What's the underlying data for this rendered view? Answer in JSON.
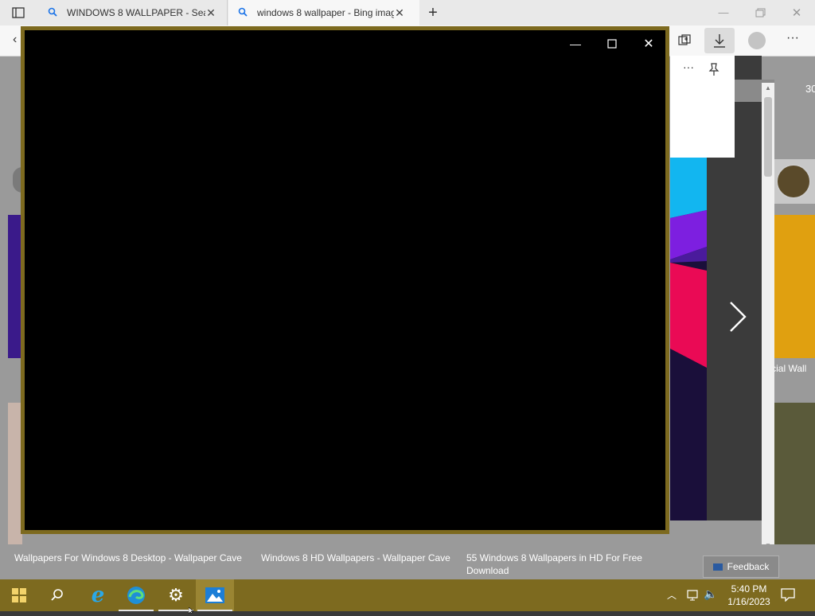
{
  "browser": {
    "tabs": [
      {
        "title": "WINDOWS 8 WALLPAPER - Searc"
      },
      {
        "title": "windows 8 wallpaper - Bing imag"
      }
    ]
  },
  "page": {
    "captions": [
      "Wallpapers For Windows 8 Desktop - Wallpaper Cave",
      "Windows 8 HD Wallpapers - Wallpaper Cave",
      "55 Windows 8 Wallpapers in HD For Free Download"
    ],
    "partial_right_caption": "fficial Wall",
    "feedback_label": "Feedback",
    "result_count_partial": "30"
  },
  "taskbar": {
    "time": "5:40 PM",
    "date": "1/16/2023"
  },
  "colors": {
    "taskbar": "#7d6a1f",
    "video_border": "#7d6a1f",
    "tab_active": "#f7f7f7",
    "tab_inactive": "#e9e9e9"
  }
}
